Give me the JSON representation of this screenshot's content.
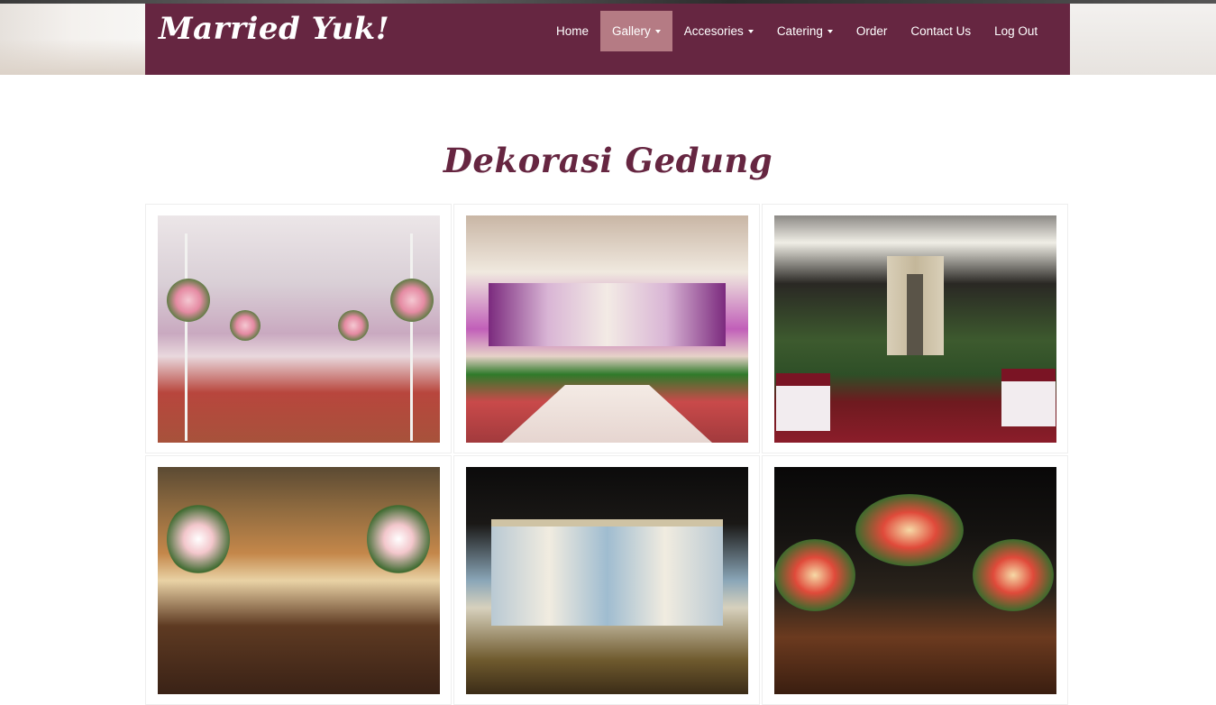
{
  "brand": {
    "name": "Married Yuk!"
  },
  "nav": {
    "items": [
      {
        "label": "Home",
        "dropdown": false,
        "active": false
      },
      {
        "label": "Gallery",
        "dropdown": true,
        "active": true
      },
      {
        "label": "Accesories",
        "dropdown": true,
        "active": false
      },
      {
        "label": "Catering",
        "dropdown": true,
        "active": false
      },
      {
        "label": "Order",
        "dropdown": false,
        "active": false
      },
      {
        "label": "Contact Us",
        "dropdown": false,
        "active": false
      },
      {
        "label": "Log Out",
        "dropdown": false,
        "active": false
      }
    ]
  },
  "page": {
    "title": "Dekorasi Gedung"
  },
  "colors": {
    "navbar": "#662641",
    "nav_active": "#b57b84",
    "title": "#662641",
    "nav_text": "#ffffff"
  },
  "gallery": {
    "photos": [
      "wedding-venue-decoration-photo",
      "wedding-venue-decoration-photo",
      "wedding-venue-decoration-photo",
      "wedding-venue-decoration-photo",
      "wedding-venue-decoration-photo",
      "wedding-venue-decoration-photo"
    ]
  }
}
